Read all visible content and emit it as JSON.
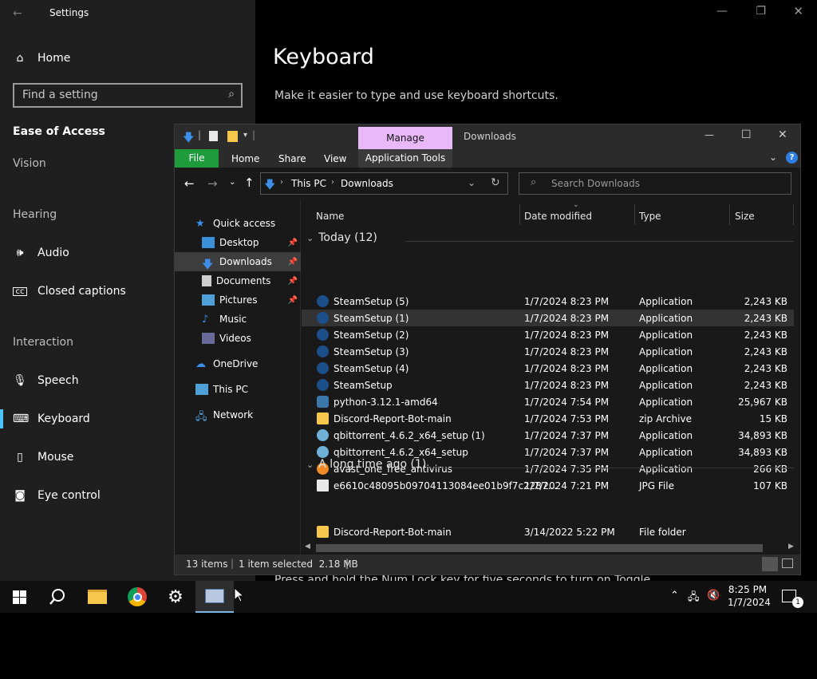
{
  "settings": {
    "title": "Settings",
    "home_label": "Home",
    "search_placeholder": "Find a setting",
    "category": "Ease of Access",
    "groups": {
      "vision": "Vision",
      "hearing": "Hearing",
      "interaction": "Interaction"
    },
    "nav": {
      "audio": "Audio",
      "closed_captions": "Closed captions",
      "speech": "Speech",
      "keyboard": "Keyboard",
      "mouse": "Mouse",
      "eye_control": "Eye control"
    },
    "page_title": "Keyboard",
    "page_subtitle": "Make it easier to type and use keyboard shortcuts.",
    "hidden_text": "Press and hold the Num Lock key for five seconds to turn on Toggle"
  },
  "explorer": {
    "title": "Downloads",
    "manage_tab": "Manage",
    "ribbon": {
      "file": "File",
      "home": "Home",
      "share": "Share",
      "view": "View",
      "app_tools": "Application Tools"
    },
    "breadcrumb": {
      "this_pc": "This PC",
      "downloads": "Downloads"
    },
    "search_placeholder": "Search Downloads",
    "nav": {
      "quick_access": "Quick access",
      "desktop": "Desktop",
      "downloads": "Downloads",
      "documents": "Documents",
      "pictures": "Pictures",
      "music": "Music",
      "videos": "Videos",
      "onedrive": "OneDrive",
      "this_pc": "This PC",
      "network": "Network"
    },
    "columns": {
      "name": "Name",
      "date": "Date modified",
      "type": "Type",
      "size": "Size"
    },
    "groups": {
      "today": "Today (12)",
      "long_ago": "A long time ago (1)"
    },
    "files_today": [
      {
        "name": "SteamSetup (5)",
        "date": "1/7/2024 8:23 PM",
        "type": "Application",
        "size": "2,243 KB"
      },
      {
        "name": "SteamSetup (1)",
        "date": "1/7/2024 8:23 PM",
        "type": "Application",
        "size": "2,243 KB"
      },
      {
        "name": "SteamSetup (2)",
        "date": "1/7/2024 8:23 PM",
        "type": "Application",
        "size": "2,243 KB"
      },
      {
        "name": "SteamSetup (3)",
        "date": "1/7/2024 8:23 PM",
        "type": "Application",
        "size": "2,243 KB"
      },
      {
        "name": "SteamSetup (4)",
        "date": "1/7/2024 8:23 PM",
        "type": "Application",
        "size": "2,243 KB"
      },
      {
        "name": "SteamSetup",
        "date": "1/7/2024 8:23 PM",
        "type": "Application",
        "size": "2,243 KB"
      },
      {
        "name": "python-3.12.1-amd64",
        "date": "1/7/2024 7:54 PM",
        "type": "Application",
        "size": "25,967 KB"
      },
      {
        "name": "Discord-Report-Bot-main",
        "date": "1/7/2024 7:53 PM",
        "type": "zip Archive",
        "size": "15 KB"
      },
      {
        "name": "qbittorrent_4.6.2_x64_setup (1)",
        "date": "1/7/2024 7:37 PM",
        "type": "Application",
        "size": "34,893 KB"
      },
      {
        "name": "qbittorrent_4.6.2_x64_setup",
        "date": "1/7/2024 7:37 PM",
        "type": "Application",
        "size": "34,893 KB"
      },
      {
        "name": "avast_one_free_antivirus",
        "date": "1/7/2024 7:35 PM",
        "type": "Application",
        "size": "266 KB"
      },
      {
        "name": "e6610c48095b09704113084ee01b9f7c2287...",
        "date": "1/7/2024 7:21 PM",
        "type": "JPG File",
        "size": "107 KB"
      }
    ],
    "files_old": [
      {
        "name": "Discord-Report-Bot-main",
        "date": "3/14/2022 5:22 PM",
        "type": "File folder",
        "size": ""
      }
    ],
    "status": {
      "items": "13 items",
      "selected": "1 item selected  2.18 MB"
    }
  },
  "taskbar": {
    "time": "8:25 PM",
    "date": "1/7/2024",
    "notif_count": "1"
  },
  "colors": {
    "accent": "#4cc2ff",
    "manage_tab": "#e8b8f8",
    "file_tab": "#1e9b3a",
    "folder": "#f5c84c"
  }
}
